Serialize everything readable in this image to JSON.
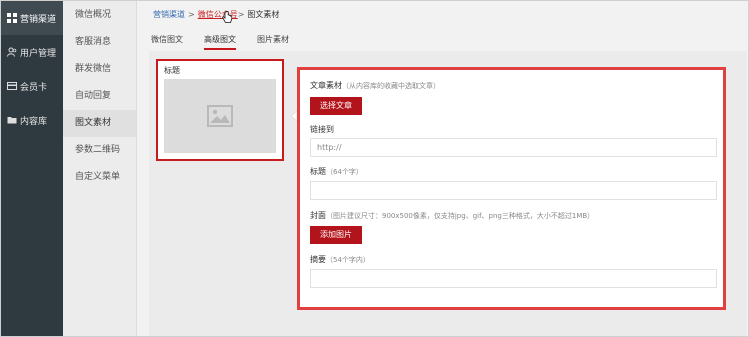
{
  "sidebar": {
    "items": [
      {
        "label": "营销渠道",
        "icon": "grid-icon"
      },
      {
        "label": "用户管理",
        "icon": "users-icon"
      },
      {
        "label": "会员卡",
        "icon": "card-icon"
      },
      {
        "label": "内容库",
        "icon": "folder-icon"
      }
    ]
  },
  "submenu": {
    "items": [
      {
        "label": "微信概况"
      },
      {
        "label": "客服消息"
      },
      {
        "label": "群发微信"
      },
      {
        "label": "自动回复"
      },
      {
        "label": "图文素材"
      },
      {
        "label": "参数二维码"
      },
      {
        "label": "自定义菜单"
      }
    ]
  },
  "breadcrumb": {
    "items": [
      "营销渠道",
      "微信公众号",
      "图文素材"
    ],
    "separator": ">"
  },
  "tabs": [
    {
      "label": "微信图文"
    },
    {
      "label": "高级图文"
    },
    {
      "label": "图片素材"
    }
  ],
  "preview": {
    "title": "标题"
  },
  "form": {
    "material_label": "文章素材",
    "material_hint": "（从内容库的收藏中选取文章）",
    "select_button": "选择文章",
    "link_label": "链接到",
    "link_value": "http://",
    "title_label": "标题",
    "title_hint": "（64个字）",
    "cover_label": "封面",
    "cover_hint": "（图片建议尺寸：900x500像素，仅支持jpg、gif、png三种格式，大小不超过1MB）",
    "add_image_button": "添加图片",
    "summary_label": "摘要",
    "summary_hint": "（54个字内）"
  },
  "colors": {
    "sidebar_bg": "#2f3a40",
    "accent_red": "#b3141b",
    "highlight_red": "#e04040",
    "link_blue": "#3a6db3"
  }
}
